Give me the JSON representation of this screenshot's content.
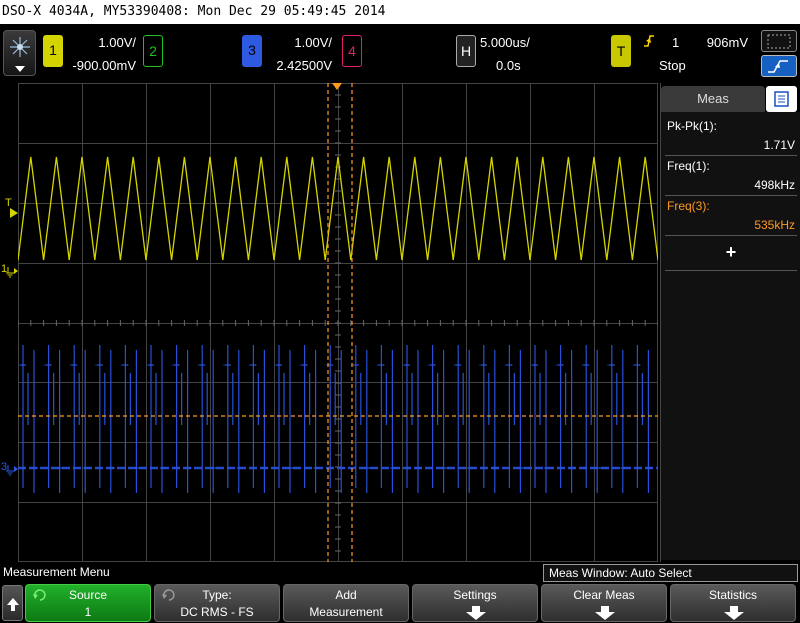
{
  "title_bar": "DSO-X 4034A, MY53390408: Mon Dec 29 05:49:45 2014",
  "channels": {
    "ch1": {
      "number": "1",
      "scale": "1.00V/",
      "offset": "-900.00mV",
      "color": "#e0e000"
    },
    "ch2": {
      "number": "2",
      "color": "#20c020"
    },
    "ch3": {
      "number": "3",
      "scale": "1.00V/",
      "offset": "2.42500V",
      "color": "#2d5ae0"
    },
    "ch4": {
      "number": "4",
      "color": "#e02070"
    }
  },
  "horizontal": {
    "label": "H",
    "timebase": "5.000us/",
    "delay": "0.0s"
  },
  "trigger": {
    "label": "T",
    "source": "1",
    "level": "906mV",
    "status": "Stop",
    "icon": "rising-edge-icon"
  },
  "markers": {
    "ch1_ground": "1",
    "ch3_ground": "3",
    "trigger_level": "T"
  },
  "measurements": {
    "tab_label": "Meas",
    "items": [
      {
        "label": "Pk-Pk(1):",
        "value": "1.71V",
        "color": "#ffffff"
      },
      {
        "label": "Freq(1):",
        "value": "498kHz",
        "color": "#ffffff"
      },
      {
        "label": "Freq(3):",
        "value": "535kHz",
        "color": "#ff9a20"
      }
    ],
    "add_label": "+"
  },
  "menu": {
    "title": "Measurement Menu",
    "meas_window": "Meas Window: Auto Select"
  },
  "softkeys": [
    {
      "l1": "Source",
      "l2": "1",
      "style": "green"
    },
    {
      "l1": "Type:",
      "l2": "DC RMS - FS",
      "style": "gray"
    },
    {
      "l1": "Add",
      "l2": "Measurement",
      "style": "gray"
    },
    {
      "l1": "Settings",
      "l2": "",
      "style": "gray"
    },
    {
      "l1": "Clear Meas",
      "l2": "",
      "style": "gray"
    },
    {
      "l1": "Statistics",
      "l2": "",
      "style": "gray"
    }
  ],
  "colors": {
    "grid": "#444444",
    "cursor": "#ff9a20",
    "ch1_trace": "#d4d400",
    "ch3_trace": "#2850d8"
  }
}
